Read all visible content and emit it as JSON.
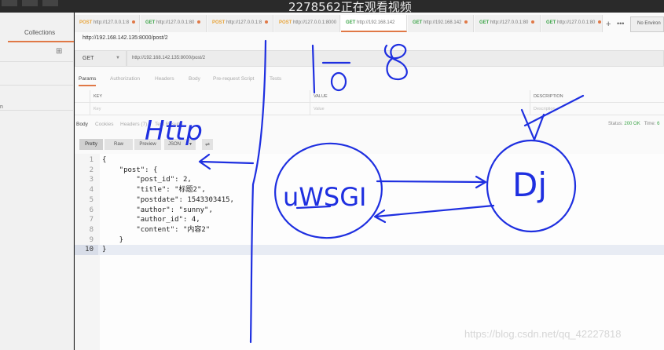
{
  "overlay": {
    "live_banner": "2278562正在观看视频",
    "watermark": "https://blog.csdn.net/qq_42227818"
  },
  "sidebar": {
    "tabs": [
      {
        "label": "Collections"
      }
    ],
    "new_collection_icon": "folder-plus-icon",
    "item_fragment": "n"
  },
  "tabs": [
    {
      "method": "POST",
      "url": "http://127.0.0.1:8",
      "dot": true
    },
    {
      "method": "GET",
      "url": "http://127.0.0.1:80",
      "dot": true
    },
    {
      "method": "POST",
      "url": "http://127.0.0.1:8",
      "dot": true
    },
    {
      "method": "POST",
      "url": "http://127.0.0.1:8000",
      "dot": false
    },
    {
      "method": "GET",
      "url": "http://192.168.142",
      "dot": false,
      "active": true
    },
    {
      "method": "GET",
      "url": "http://192.168.142",
      "dot": true
    },
    {
      "method": "GET",
      "url": "http://127.0.0.1:80",
      "dot": true
    },
    {
      "method": "GET",
      "url": "http://127.0.0.1:80",
      "dot": true
    }
  ],
  "tab_add": "+",
  "tab_more": "•••",
  "environment": "No Environ",
  "request": {
    "title": "http://192.168.142.135:8000/post/2",
    "method": "GET",
    "url": "http://192.168.142.135:8000/post/2"
  },
  "request_tabs": [
    "Params",
    "Authorization",
    "Headers",
    "Body",
    "Pre-request Script",
    "Tests"
  ],
  "params_table": {
    "columns": [
      "KEY",
      "VALUE",
      "DESCRIPTION"
    ],
    "placeholder_row": [
      "Key",
      "Value",
      "Description"
    ]
  },
  "response": {
    "tabs": [
      "Body",
      "Cookies",
      "Headers (7)",
      "Test Results"
    ],
    "status_label": "Status:",
    "status_value": "200 OK",
    "time_label": "Time:",
    "time_value": "6",
    "format_buttons": [
      "Pretty",
      "Raw",
      "Preview"
    ],
    "format_select": "JSON",
    "wrap_icon": "wrap-lines-icon",
    "lines": [
      {
        "n": "1",
        "text": "{"
      },
      {
        "n": "2",
        "text": "    \"post\": {"
      },
      {
        "n": "3",
        "text": "        \"post_id\": 2,"
      },
      {
        "n": "4",
        "text": "        \"title\": \"标题2\","
      },
      {
        "n": "5",
        "text": "        \"postdate\": 1543303415,"
      },
      {
        "n": "6",
        "text": "        \"author\": \"sunny\","
      },
      {
        "n": "7",
        "text": "        \"author_id\": 4,"
      },
      {
        "n": "8",
        "text": "        \"content\": \"内容2\""
      },
      {
        "n": "9",
        "text": "    }"
      },
      {
        "n": "10",
        "text": "}"
      }
    ]
  },
  "annotations": {
    "http_label": "Http",
    "uwsgi_label": "uWSGI",
    "d_label": "Dj",
    "io_label": "I/O"
  }
}
